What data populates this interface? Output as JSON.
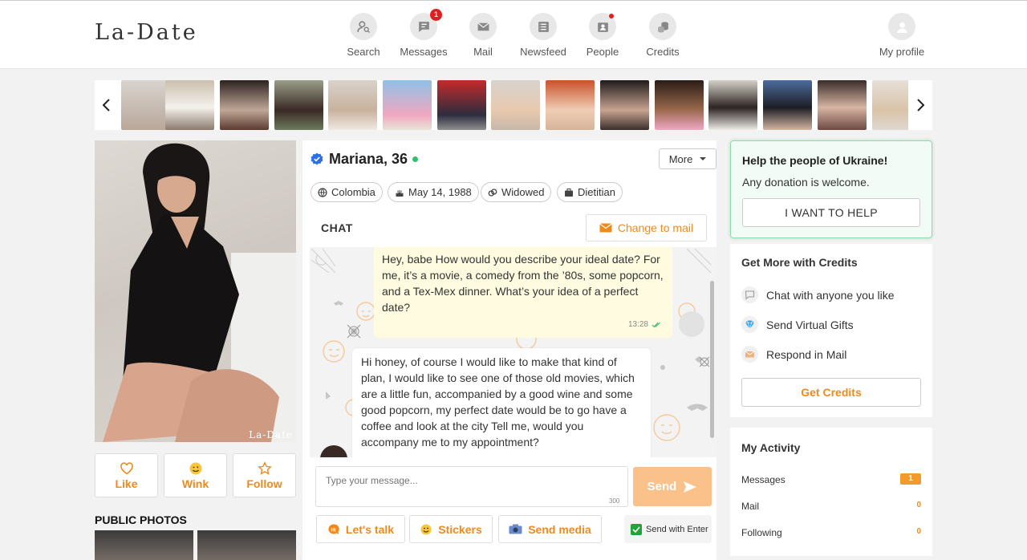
{
  "header": {
    "logo": "La-Date",
    "nav": [
      {
        "label": "Search",
        "icon": "search-icon",
        "badge": ""
      },
      {
        "label": "Messages",
        "icon": "messages-icon",
        "badge": "1"
      },
      {
        "label": "Mail",
        "icon": "mail-icon",
        "badge": ""
      },
      {
        "label": "Newsfeed",
        "icon": "newsfeed-icon",
        "badge": ""
      },
      {
        "label": "People",
        "icon": "people-icon",
        "badge": ""
      },
      {
        "label": "Credits",
        "icon": "credits-icon",
        "badge": ""
      }
    ],
    "profile_label": "My profile"
  },
  "profile": {
    "name": "Mariana, 36",
    "country": "Colombia",
    "birthday": "May 14, 1988",
    "status": "Widowed",
    "job": "Dietitian",
    "photo_watermark": "La-Date",
    "like_label": "Like",
    "wink_label": "Wink",
    "follow_label": "Follow",
    "public_photos_title": "PUBLIC PHOTOS"
  },
  "chat": {
    "more_label": "More",
    "title": "CHAT",
    "change_to_mail_label": "Change to mail",
    "messages": [
      {
        "from": "me",
        "text": "Hey, babe How would you describe your ideal date? For me, it’s a movie, a comedy from the ’80s, some popcorn, and a Tex-Mex dinner. What’s your idea of a perfect date?",
        "time": "13:28"
      },
      {
        "from": "her",
        "text": "Hi honey, of course I would like to make that kind of plan, I would like to see one of those old movies, which are a little fun, accompanied by a good wine and some good popcorn, my perfect date would be to go have a coffee and look at the city Tell me, would you accompany me to my appointment?"
      }
    ],
    "input_placeholder": "Type your message...",
    "char_limit": "300",
    "send_label": "Send",
    "lets_talk_label": "Let's talk",
    "stickers_label": "Stickers",
    "send_media_label": "Send media",
    "send_with_enter_label": "Send with Enter"
  },
  "ukraine": {
    "title": "Help the people of Ukraine!",
    "subtitle": "Any donation is welcome.",
    "button": "I WANT TO HELP"
  },
  "credits": {
    "title": "Get More with Credits",
    "items": [
      "Chat with anyone you like",
      "Send Virtual Gifts",
      "Respond in Mail"
    ],
    "button": "Get Credits"
  },
  "activity": {
    "title": "My Activity",
    "rows": [
      {
        "label": "Messages",
        "value": "1"
      },
      {
        "label": "Mail",
        "value": "0"
      },
      {
        "label": "Following",
        "value": "0"
      }
    ]
  },
  "colors": {
    "accent": "#ef8a1c",
    "badge": "#e0201e",
    "online": "#2fbf71",
    "help_border": "#8fdcab"
  }
}
